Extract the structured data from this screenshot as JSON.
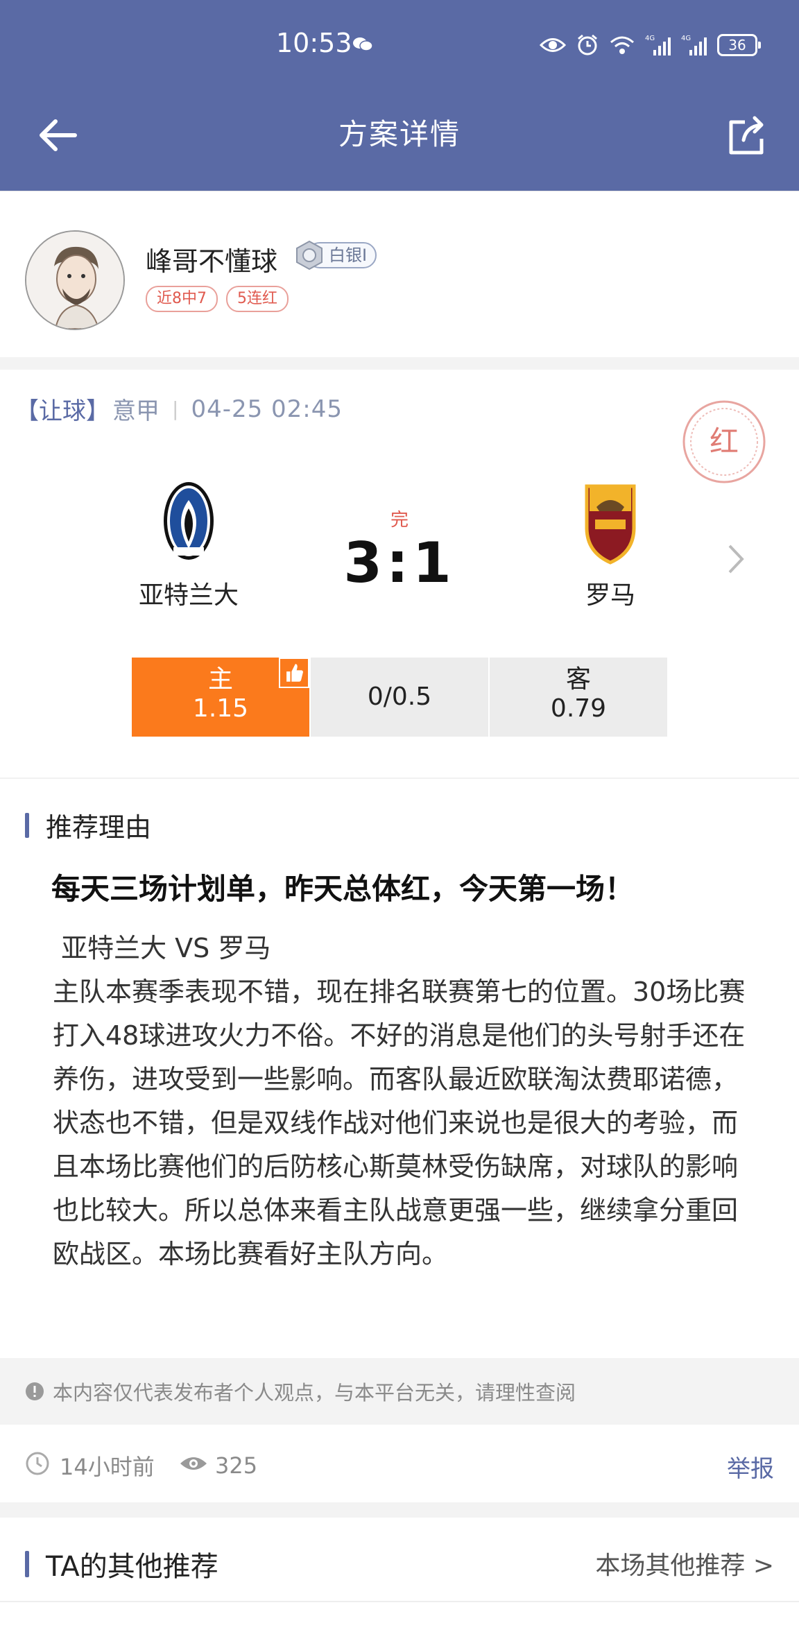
{
  "status_bar": {
    "time": "10:53",
    "battery": "36",
    "network_1": "4G",
    "network_2": "4G"
  },
  "header": {
    "title": "方案详情",
    "background": "#5a6aa5"
  },
  "author": {
    "name": "峰哥不懂球",
    "level": "白银I",
    "tags": [
      "近8中7",
      "5连红"
    ]
  },
  "match": {
    "type": "【让球】",
    "league": "意甲",
    "separator": "|",
    "datetime": "04-25  02:45",
    "status": "完",
    "score": "3:1",
    "home_team": "亚特兰大",
    "away_team": "罗马",
    "stamp_text": "红",
    "odds": {
      "home_label": "主",
      "home_value": "1.15",
      "line": "0/0.5",
      "away_label": "客",
      "away_value": "0.79"
    },
    "accent_color": "#fb7a1c"
  },
  "reason": {
    "section_title": "推荐理由",
    "headline": "每天三场计划单，昨天总体红，今天第一场！",
    "body": " 亚特兰大 VS 罗马\n主队本赛季表现不错，现在排名联赛第七的位置。30场比赛打入48球进攻火力不俗。不好的消息是他们的头号射手还在养伤，进攻受到一些影响。而客队最近欧联淘汰费耶诺德，状态也不错，但是双线作战对他们来说也是很大的考验，而且本场比赛他们的后防核心斯莫林受伤缺席，对球队的影响也比较大。所以总体来看主队战意更强一些，继续拿分重回欧战区。本场比赛看好主队方向。"
  },
  "disclaimer": "本内容仅代表发布者个人观点，与本平台无关，请理性查阅",
  "meta": {
    "time_ago": "14小时前",
    "views": "325",
    "report": "举报"
  },
  "other": {
    "title": "TA的其他推荐",
    "link": "本场其他推荐 >"
  }
}
